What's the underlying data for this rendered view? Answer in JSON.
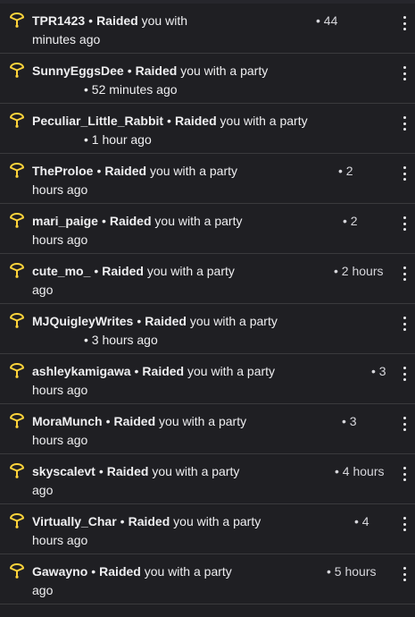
{
  "colors": {
    "background": "#1f1f23",
    "icon": "#ffd43b",
    "text": "#efeff1",
    "divider": "#3a3a3d"
  },
  "icon_name": "raid-icon",
  "activity": [
    {
      "user": "TPR1423",
      "action": "Raided",
      "rest": "you with",
      "time_right": "• 44",
      "time_line2": "minutes ago"
    },
    {
      "user": "SunnyEggsDee",
      "action": "Raided",
      "rest": "you with a party",
      "time_right": "",
      "time_line2": "• 52 minutes ago"
    },
    {
      "user": "Peculiar_Little_Rabbit",
      "action": "Raided",
      "rest": "you with a party",
      "time_right": "",
      "time_line2": "• 1 hour ago"
    },
    {
      "user": "TheProloe",
      "action": "Raided",
      "rest": "you with a party",
      "time_right": "• 2",
      "time_line2": "hours ago"
    },
    {
      "user": "mari_paige",
      "action": "Raided",
      "rest": "you with a party",
      "time_right": "• 2",
      "time_line2": "hours ago"
    },
    {
      "user": "cute_mo_",
      "action": "Raided",
      "rest": "you with a party",
      "time_right": "• 2 hours",
      "time_line2": "ago"
    },
    {
      "user": "MJQuigleyWrites",
      "action": "Raided",
      "rest": "you with a party",
      "time_right": "",
      "time_line2": "• 3 hours ago"
    },
    {
      "user": "ashleykamigawa",
      "action": "Raided",
      "rest": "you with a party",
      "time_right": "• 3",
      "time_line2": "hours ago"
    },
    {
      "user": "MoraMunch",
      "action": "Raided",
      "rest": "you with a party",
      "time_right": "• 3",
      "time_line2": "hours ago"
    },
    {
      "user": "skyscalevt",
      "action": "Raided",
      "rest": "you with a party",
      "time_right": "• 4 hours",
      "time_line2": "ago"
    },
    {
      "user": "Virtually_Char",
      "action": "Raided",
      "rest": "you with a party",
      "time_right": "• 4",
      "time_line2": "hours ago"
    },
    {
      "user": "Gawayno",
      "action": "Raided",
      "rest": "you with a party",
      "time_right": "• 5 hours",
      "time_line2": "ago"
    }
  ]
}
